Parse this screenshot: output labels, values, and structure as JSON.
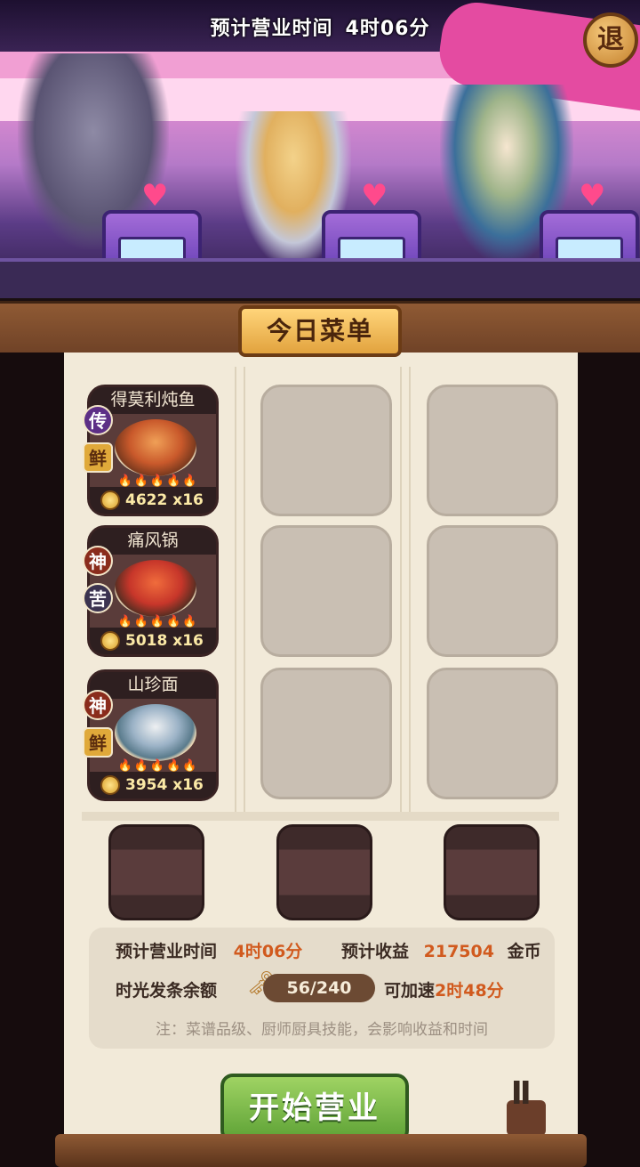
{
  "header": {
    "timer_label": "预计营业时间",
    "timer_value": "4时06分",
    "exit_label": "退"
  },
  "menu": {
    "title": "今日菜单",
    "dishes": [
      {
        "name": "得莫利炖鱼",
        "rank": "传",
        "flavor": "鲜",
        "heat_level": 5,
        "price": "4622",
        "count": "x16"
      },
      {
        "name": "痛风锅",
        "rank": "神",
        "flavor": "苦",
        "heat_level": 5,
        "price": "5018",
        "count": "x16"
      },
      {
        "name": "山珍面",
        "rank": "神",
        "flavor": "鲜",
        "heat_level": 5,
        "price": "3954",
        "count": "x16"
      }
    ],
    "empty_slots": 6,
    "chef_seats": 3
  },
  "summary": {
    "time_label": "预计营业时间",
    "time_value": "4时06分",
    "income_label": "预计收益",
    "income_value": "217504",
    "income_unit": "金币",
    "timebar_label": "时光发条余额",
    "timebar_value": "56/240",
    "speedup_label": "可加速",
    "speedup_value": "2时48分",
    "note": "注：菜谱品级、厨师厨具技能，会影响收益和时间"
  },
  "actions": {
    "start_label": "开始营业"
  },
  "colors": {
    "accent": "#d15a1e",
    "start_button": "#6fb040",
    "paper": "#f2ead9",
    "wood": "#8f5a34"
  }
}
